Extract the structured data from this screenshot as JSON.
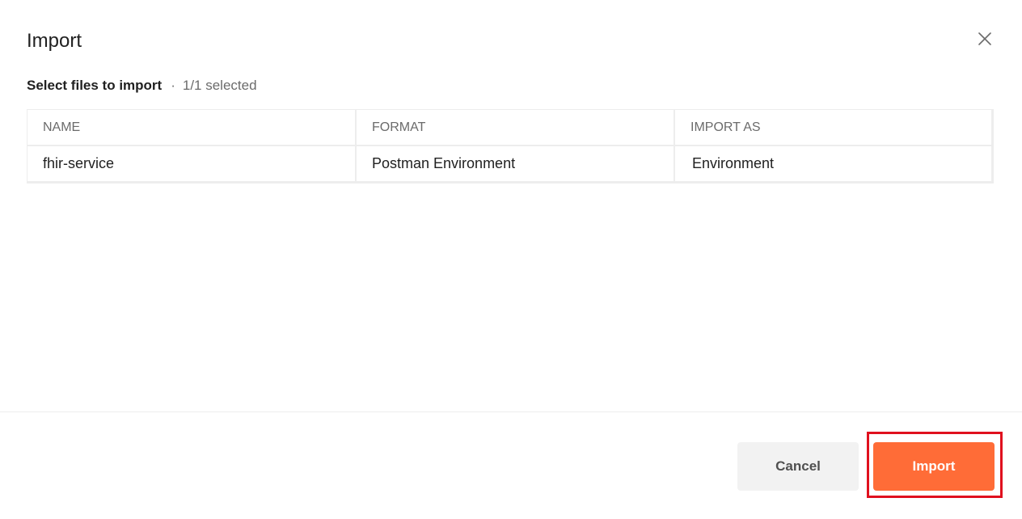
{
  "dialog": {
    "title": "Import",
    "close_icon": "close-icon"
  },
  "subheader": {
    "label": "Select files to import",
    "separator": "·",
    "selected_count": "1/1 selected"
  },
  "table": {
    "headers": [
      "NAME",
      "FORMAT",
      "IMPORT AS"
    ],
    "rows": [
      {
        "name": "fhir-service",
        "format": "Postman Environment",
        "import_as": "Environment"
      }
    ]
  },
  "footer": {
    "cancel_label": "Cancel",
    "import_label": "Import"
  },
  "colors": {
    "accent": "#ff6c37",
    "highlight": "#e0101e"
  }
}
